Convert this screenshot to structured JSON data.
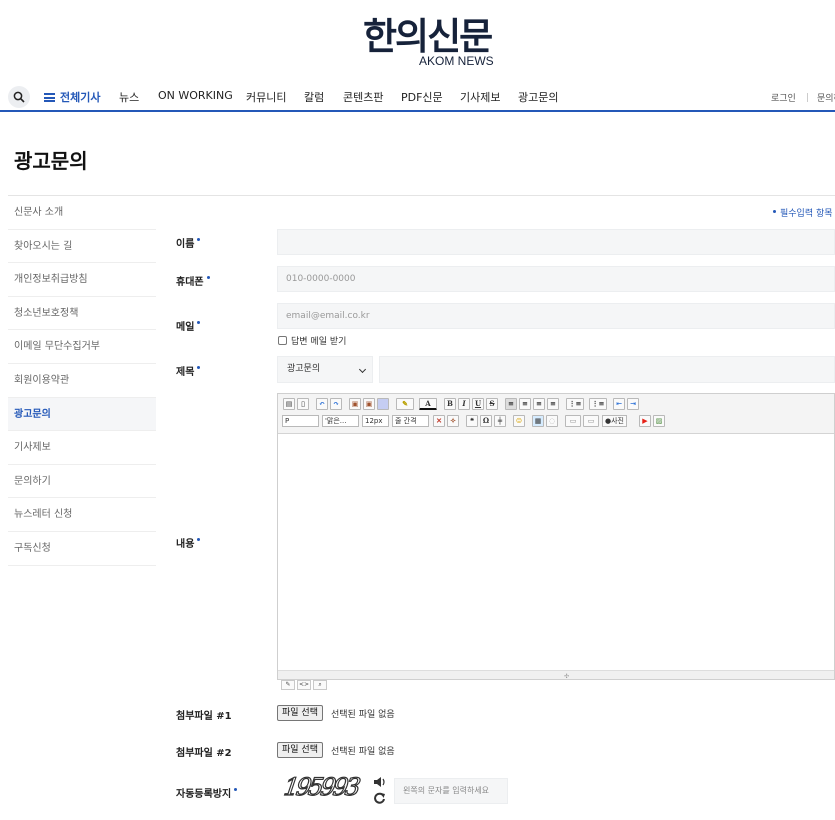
{
  "header": {
    "logo_main": "한의신문",
    "logo_sub": "AKOM NEWS"
  },
  "gnb": {
    "all_menu": "전체기사",
    "items": [
      "뉴스",
      "ON WORKING",
      "커뮤니티",
      "칼럼",
      "콘텐츠판",
      "PDF신문",
      "기사제보",
      "광고문의"
    ],
    "login": "로그인",
    "inquiry": "문의하"
  },
  "page_title": "광고문의",
  "sidebar": {
    "items": [
      "신문사 소개",
      "찾아오시는 길",
      "개인정보취급방침",
      "청소년보호정책",
      "이메일 무단수집거부",
      "회원이용약관",
      "광고문의",
      "기사제보",
      "문의하기",
      "뉴스레터 신청",
      "구독신청"
    ],
    "active_index": 6
  },
  "form": {
    "required_note": "필수입력 항목",
    "name_label": "이름",
    "phone_label": "휴대폰",
    "phone_placeholder": "010-0000-0000",
    "email_label": "메일",
    "email_placeholder": "email@email.co.kr",
    "reply_checkbox": "답변 메일 받기",
    "reply_checked": false,
    "subject_label": "제목",
    "subject_select": "광고문의",
    "content_label": "내용",
    "editor": {
      "format_select": "P",
      "font_select": "'맑은...",
      "size_select": "12px",
      "spacing_select": "줄 간격",
      "bold": "B",
      "italic": "I",
      "underline": "U",
      "strike": "S",
      "quote": "❝",
      "omega": "Ω",
      "photo_button": "사진"
    },
    "attach1_label": "첨부파일 #1",
    "attach2_label": "첨부파일 #2",
    "file_button": "파일 선택",
    "file_status": "선택된 파일 없음",
    "captcha_label": "자동등록방지",
    "captcha_code": "195993",
    "captcha_placeholder": "왼쪽의 문자를 입력하세요"
  }
}
